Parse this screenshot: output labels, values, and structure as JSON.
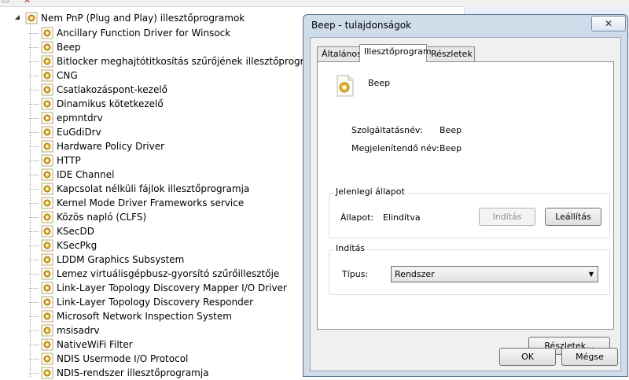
{
  "tree": {
    "root_label": "Nem PnP (Plug and Play) illesztőprogramok",
    "items": [
      "Ancillary Function Driver for Winsock",
      "Beep",
      "Bitlocker meghajtótitkosítás szűrőjének illesztőprogramja",
      "CNG",
      "Csatlakozáspont-kezelő",
      "Dinamikus kötetkezelő",
      "epmntdrv",
      "EuGdiDrv",
      "Hardware Policy Driver",
      "HTTP",
      "IDE Channel",
      "Kapcsolat nélküli fájlok illesztőprogramja",
      "Kernel Mode Driver Frameworks service",
      "Közös napló (CLFS)",
      "KSecDD",
      "KSecPkg",
      "LDDM Graphics Subsystem",
      "Lemez virtuálisgépbusz-gyorsító szűrőillesztője",
      "Link-Layer Topology Discovery Mapper I/O Driver",
      "Link-Layer Topology Discovery Responder",
      "Microsoft Network Inspection System",
      "msisadrv",
      "NativeWiFi Filter",
      "NDIS Usermode I/O Protocol",
      "NDIS-rendszer illesztőprogramja"
    ]
  },
  "dialog": {
    "title": "Beep - tulajdonságok",
    "close_glyph": "✕",
    "tabs": [
      "Általános",
      "Illesztőprogram",
      "Részletek"
    ],
    "active_tab_index": 1,
    "device_name": "Beep",
    "service_name_label": "Szolgáltatásnév:",
    "service_name_value": "Beep",
    "display_name_label": "Megjelenítendő név:",
    "display_name_value": "Beep",
    "current_state": {
      "group_label": "Jelenlegi állapot",
      "state_label": "Állapot:",
      "state_value": "Elindítva",
      "start_label": "Indítás",
      "stop_label": "Leállítás"
    },
    "startup": {
      "group_label": "Indítás",
      "type_label": "Típus:",
      "type_value": "Rendszer"
    },
    "details_button": "Részletek...",
    "ok_button": "OK",
    "cancel_button": "Mégse"
  },
  "colors": {
    "dialog_frame": "#cfdcea",
    "client_bg": "#f0f0f0",
    "disabled_text": "#8d8d8d"
  }
}
